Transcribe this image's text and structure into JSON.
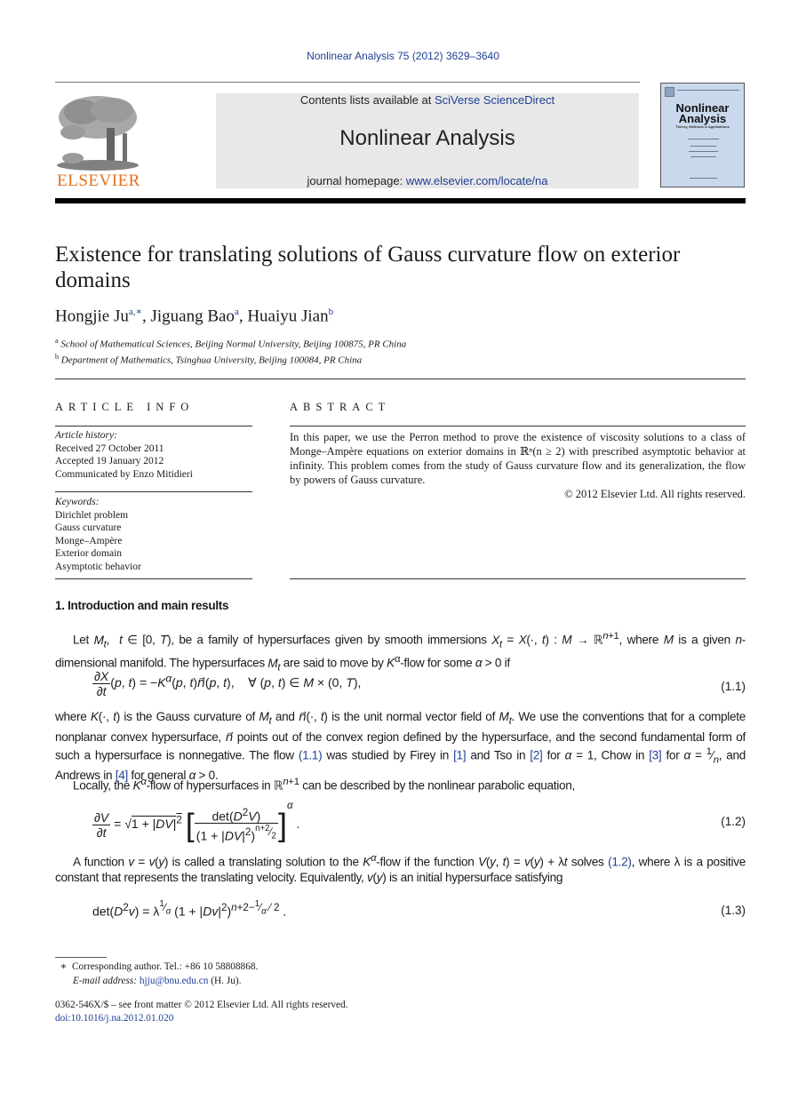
{
  "citation": "Nonlinear Analysis 75 (2012) 3629–3640",
  "header": {
    "contents_prefix": "Contents lists available at ",
    "contents_link": "SciVerse ScienceDirect",
    "journal_name": "Nonlinear Analysis",
    "homepage_prefix": "journal homepage: ",
    "homepage_link": "www.elsevier.com/locate/na",
    "publisher_logo_text": "ELSEVIER",
    "cover_title_line1": "Nonlinear",
    "cover_title_line2": "Analysis",
    "cover_subtitle": "Theory, Methods & Applications"
  },
  "colors": {
    "link": "#1f3f94",
    "elsevier_orange": "#e4701e",
    "header_box": "#e8e8e8",
    "cover_blue": "#c9d8ec"
  },
  "article": {
    "title": "Existence for translating solutions of Gauss curvature flow on exterior domains",
    "authors": [
      {
        "name": "Hongjie Ju",
        "marks": "a,∗"
      },
      {
        "name": "Jiguang Bao",
        "marks": "a"
      },
      {
        "name": "Huaiyu Jian",
        "marks": "b"
      }
    ],
    "affiliations": [
      {
        "mark": "a",
        "text": "School of Mathematical Sciences, Beijing Normal University, Beijing 100875, PR China"
      },
      {
        "mark": "b",
        "text": "Department of Mathematics, Tsinghua University, Beijing 100084, PR China"
      }
    ]
  },
  "article_info": {
    "heading": "ARTICLE INFO",
    "history_label": "Article history:",
    "history": [
      "Received 27 October 2011",
      "Accepted 19 January 2012",
      "Communicated by Enzo Mitidieri"
    ],
    "keywords_label": "Keywords:",
    "keywords": [
      "Dirichlet problem",
      "Gauss curvature",
      "Monge–Ampère",
      "Exterior domain",
      "Asymptotic behavior"
    ]
  },
  "abstract": {
    "heading": "ABSTRACT",
    "text_before": "In this paper, we use the Perron method to prove the existence of viscosity solutions to a class of Monge–Ampère equations on exterior domains in ",
    "math": "ℝⁿ(n ≥ 2)",
    "text_after": " with prescribed asymptotic behavior at infinity. This problem comes from the study of Gauss curvature flow and its generalization, the flow by powers of Gauss curvature.",
    "copyright": "© 2012 Elsevier Ltd. All rights reserved."
  },
  "section": {
    "title": "1.  Introduction and main results",
    "eq_labels": [
      "(1.1)",
      "(1.2)",
      "(1.3)"
    ],
    "refs": {
      "eq11": "(1.1)",
      "eq12": "(1.2)",
      "r1": "[1]",
      "r2": "[2]",
      "r3": "[3]",
      "r4": "[4]"
    }
  },
  "footnotes": {
    "star": "∗",
    "corresponding": "Corresponding author. Tel.: +86 10 58808868.",
    "email_label": "E-mail address:",
    "email": "hjju@bnu.edu.cn",
    "email_suffix": " (H. Ju).",
    "issn_line": "0362-546X/$ – see front matter © 2012 Elsevier Ltd. All rights reserved.",
    "doi": "doi:10.1016/j.na.2012.01.020"
  }
}
